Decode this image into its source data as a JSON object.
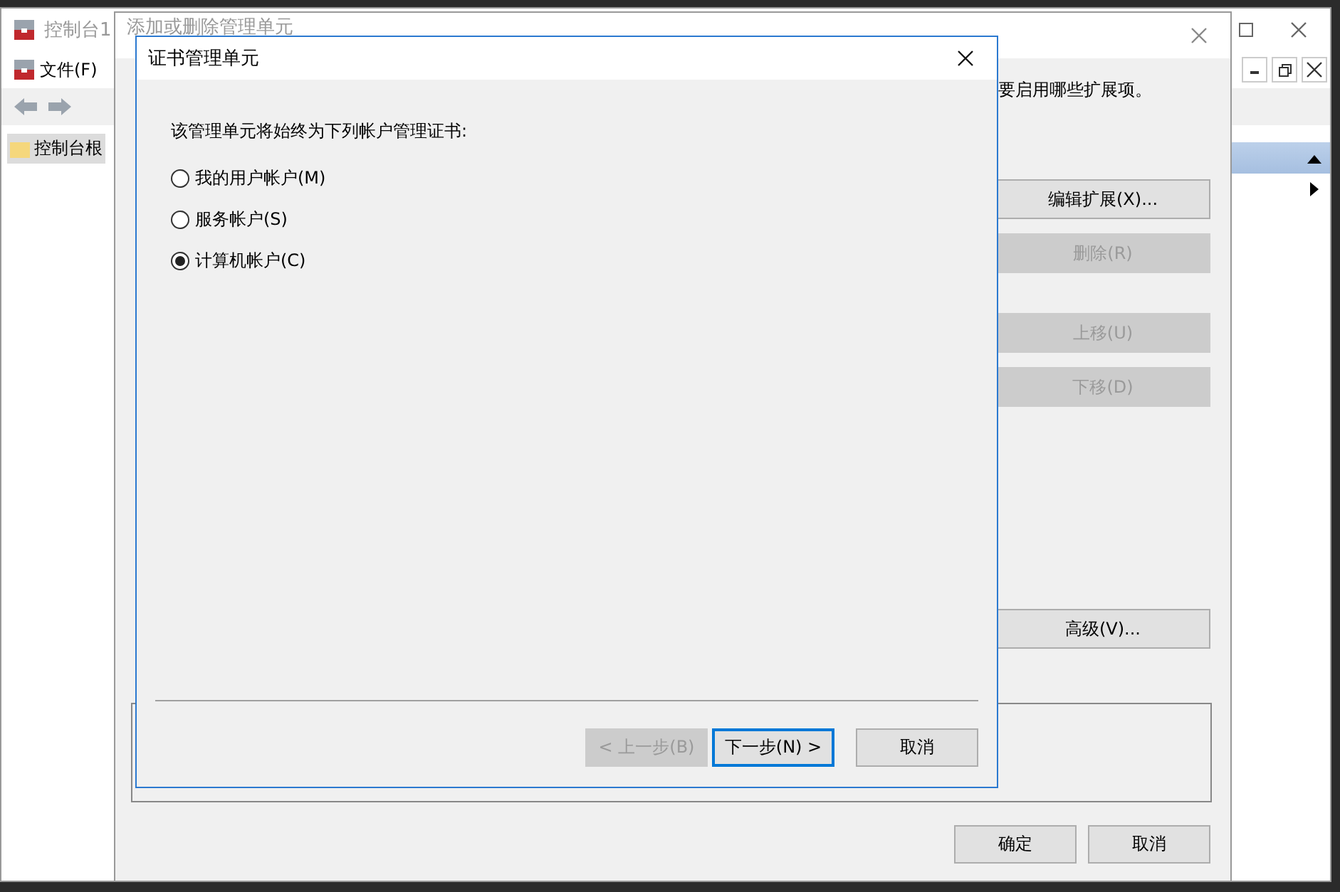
{
  "main_window": {
    "title": "控制台1",
    "menu": [
      "文件(F)"
    ],
    "tree": [
      {
        "label": "控制台根",
        "selected": true
      }
    ]
  },
  "snapin_dialog": {
    "title": "添加或删除管理单元",
    "hint": "要启用哪些扩展项。",
    "side_buttons": [
      {
        "label": "编辑扩展(X)...",
        "disabled": false
      },
      {
        "label": "删除(R)",
        "disabled": true
      },
      {
        "label": "上移(U)",
        "disabled": true
      },
      {
        "label": "下移(D)",
        "disabled": true
      },
      {
        "label": "高级(V)...",
        "disabled": false
      }
    ],
    "buttons": [
      {
        "label": "确定",
        "disabled": false
      },
      {
        "label": "取消",
        "disabled": false
      }
    ]
  },
  "cert_dialog": {
    "title": "证书管理单元",
    "prompt": "该管理单元将始终为下列帐户管理证书:",
    "options": [
      {
        "label": "我的用户帐户(M)",
        "selected": false
      },
      {
        "label": "服务帐户(S)",
        "selected": false
      },
      {
        "label": "计算机帐户(C)",
        "selected": true
      }
    ],
    "buttons": [
      {
        "label": "< 上一步(B)",
        "disabled": true,
        "default": false
      },
      {
        "label": "下一步(N) >",
        "disabled": false,
        "default": true
      },
      {
        "label": "取消",
        "disabled": false,
        "default": false
      }
    ]
  }
}
